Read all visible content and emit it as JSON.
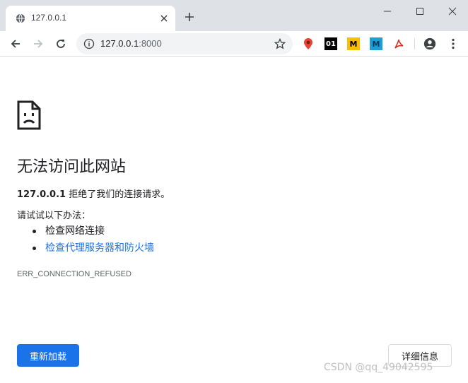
{
  "tab": {
    "title": "127.0.0.1",
    "favicon": "globe-icon"
  },
  "address": {
    "host": "127.0.0.1",
    "port": ":8000"
  },
  "extensions": [
    {
      "name": "maps-pin-icon",
      "color": "#ea4335"
    },
    {
      "name": "ext-01-icon",
      "label": "01"
    },
    {
      "name": "ext-m-yellow-icon",
      "label": "M",
      "color": "#fbbc04"
    },
    {
      "name": "ext-m-blue-icon",
      "label": "M",
      "color": "#1a9fd9"
    },
    {
      "name": "acrobat-icon",
      "color": "#d93025"
    }
  ],
  "error": {
    "heading": "无法访问此网站",
    "summary_host": "127.0.0.1",
    "summary_text": " 拒绝了我们的连接请求。",
    "suggest_title": "请试试以下办法：",
    "suggestions": [
      "检查网络连接",
      "检查代理服务器和防火墙"
    ],
    "code": "ERR_CONNECTION_REFUSED"
  },
  "buttons": {
    "reload": "重新加载",
    "details": "详细信息"
  },
  "watermark": "CSDN @qq_49042595",
  "colors": {
    "accent": "#1a73e8",
    "chrome_bg": "#dee1e6"
  }
}
